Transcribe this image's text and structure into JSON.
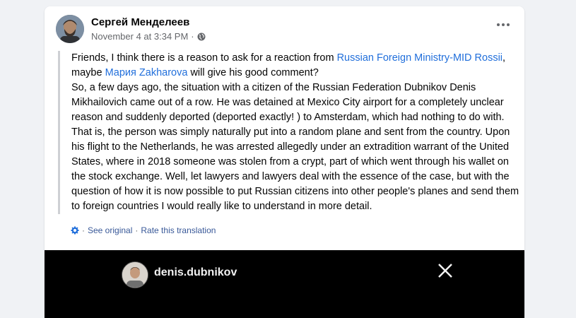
{
  "post": {
    "author": "Сергей Менделеев",
    "timestamp": "November 4 at 3:34 PM",
    "separator": "·",
    "privacy_icon": "globe-icon",
    "more_icon": "more-horizontal-icon"
  },
  "body": {
    "p1_pre": "Friends, I think there is a reason to ask for a reaction from ",
    "p1_link": "Russian Foreign Ministry-MID Rossii",
    "p1_post": ",",
    "p2_pre": "maybe ",
    "p2_link": "Мария Zakharova",
    "p2_post": " will give his good comment?",
    "p3": "So, a few days ago, the situation with a citizen of the Russian Federation Dubnikov Denis Mikhailovich came out of a row. He was detained at Mexico City airport for a completely unclear reason and suddenly deported (deported exactly! ) to Amsterdam, which had nothing to do with. That is, the person was simply naturally put into a random plane and sent from the country. Upon his flight to the Netherlands, he was arrested allegedly under an extradition warrant of the United States, where in 2018 someone was stolen from a crypt, part of which went through his wallet on the stock exchange. Well, let lawyers and lawyers deal with the essence of the case, but with the question of how it is now possible to put Russian citizens into other people's planes and send them to foreign countries I would really like to understand in more detail."
  },
  "translation": {
    "see_original": "See original",
    "rate": "Rate this translation",
    "dot": "·"
  },
  "media": {
    "username": "denis.dubnikov",
    "close_icon": "close-icon"
  },
  "colors": {
    "link": "#216fdb",
    "meta": "#65676b",
    "background": "#f0f2f5"
  }
}
